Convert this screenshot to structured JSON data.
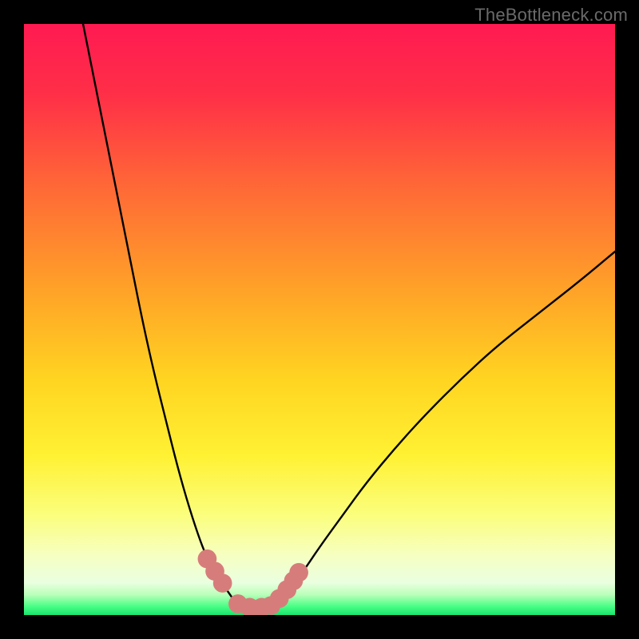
{
  "watermark": "TheBottleneck.com",
  "colors": {
    "frame": "#000000",
    "gradient_stops": [
      {
        "offset": 0.0,
        "color": "#ff1a52"
      },
      {
        "offset": 0.12,
        "color": "#ff2f47"
      },
      {
        "offset": 0.28,
        "color": "#ff6a36"
      },
      {
        "offset": 0.45,
        "color": "#ffa228"
      },
      {
        "offset": 0.6,
        "color": "#ffd421"
      },
      {
        "offset": 0.73,
        "color": "#fff133"
      },
      {
        "offset": 0.83,
        "color": "#fbfe7c"
      },
      {
        "offset": 0.9,
        "color": "#f6ffc2"
      },
      {
        "offset": 0.945,
        "color": "#eaffe0"
      },
      {
        "offset": 0.965,
        "color": "#bcffba"
      },
      {
        "offset": 0.985,
        "color": "#4bff85"
      },
      {
        "offset": 1.0,
        "color": "#18e56e"
      }
    ],
    "curve": "#000000",
    "marker": "#d67d7b"
  },
  "chart_data": {
    "type": "line",
    "title": "",
    "xlabel": "",
    "ylabel": "",
    "xlim": [
      0,
      100
    ],
    "ylim": [
      0,
      100
    ],
    "series": [
      {
        "name": "left-branch",
        "x": [
          10,
          12,
          14,
          16,
          18,
          20,
          22,
          24,
          26,
          28,
          30,
          31.5,
          33,
          34.5,
          35.5,
          36.5
        ],
        "y": [
          100,
          90,
          80,
          70,
          60,
          50,
          41,
          33,
          25,
          18,
          12,
          8.5,
          6,
          4,
          2.5,
          1.6
        ]
      },
      {
        "name": "right-branch",
        "x": [
          42,
          44,
          47,
          50,
          54,
          58,
          63,
          68,
          74,
          80,
          87,
          94,
          100
        ],
        "y": [
          1.6,
          3.5,
          7,
          11.5,
          17,
          22.5,
          28.5,
          34,
          40,
          45.5,
          51,
          56.5,
          61.5
        ]
      },
      {
        "name": "valley-floor",
        "x": [
          36.5,
          38,
          39.5,
          41,
          42
        ],
        "y": [
          1.6,
          1.3,
          1.2,
          1.3,
          1.6
        ]
      }
    ],
    "markers": [
      {
        "x": 31.0,
        "y": 9.5,
        "r": 1.6
      },
      {
        "x": 32.3,
        "y": 7.4,
        "r": 1.6
      },
      {
        "x": 33.6,
        "y": 5.4,
        "r": 1.6
      },
      {
        "x": 36.2,
        "y": 1.9,
        "r": 1.6
      },
      {
        "x": 38.2,
        "y": 1.3,
        "r": 1.6
      },
      {
        "x": 40.2,
        "y": 1.3,
        "r": 1.6
      },
      {
        "x": 41.8,
        "y": 1.6,
        "r": 1.6
      },
      {
        "x": 43.2,
        "y": 2.8,
        "r": 1.6
      },
      {
        "x": 44.5,
        "y": 4.3,
        "r": 1.6
      },
      {
        "x": 45.6,
        "y": 5.8,
        "r": 1.6
      },
      {
        "x": 46.5,
        "y": 7.2,
        "r": 1.6
      }
    ]
  }
}
